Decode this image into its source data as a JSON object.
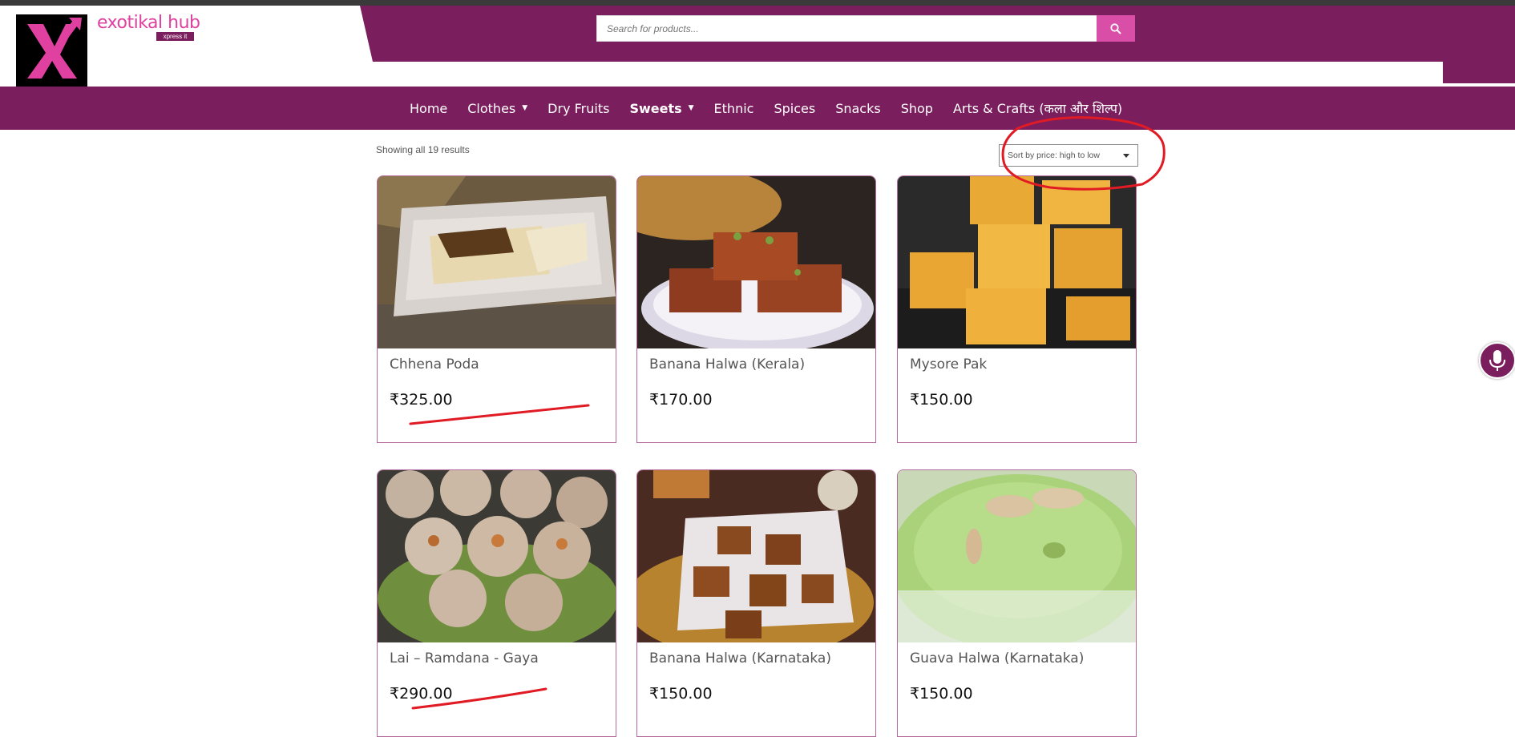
{
  "brand": {
    "name": "exotikal hub",
    "tagline": "xpress it",
    "logo_glyph": "X"
  },
  "search": {
    "placeholder": "Search for products...",
    "button_icon": "search-icon"
  },
  "nav": {
    "items": [
      {
        "label": "Home",
        "has_dropdown": false
      },
      {
        "label": "Clothes",
        "has_dropdown": true
      },
      {
        "label": "Dry Fruits",
        "has_dropdown": false
      },
      {
        "label": "Sweets",
        "has_dropdown": true,
        "active": true
      },
      {
        "label": "Ethnic",
        "has_dropdown": false
      },
      {
        "label": "Spices",
        "has_dropdown": false
      },
      {
        "label": "Snacks",
        "has_dropdown": false
      },
      {
        "label": "Shop",
        "has_dropdown": false
      },
      {
        "label": "Arts & Crafts (कला और शिल्प)",
        "has_dropdown": false
      }
    ]
  },
  "listing": {
    "results_text": "Showing all 19 results",
    "sort_value": "Sort by price: high to low"
  },
  "products": [
    {
      "name": "Chhena Poda",
      "price": "₹325.00"
    },
    {
      "name": "Banana Halwa (Kerala)",
      "price": "₹170.00"
    },
    {
      "name": "Mysore Pak",
      "price": "₹150.00"
    },
    {
      "name": "Lai – Ramdana - Gaya",
      "price": "₹290.00"
    },
    {
      "name": "Banana Halwa (Karnataka)",
      "price": "₹150.00"
    },
    {
      "name": "Guava Halwa (Karnataka)",
      "price": "₹150.00"
    }
  ],
  "colors": {
    "brand_purple": "#7b1e5e",
    "accent_pink": "#d94fa8",
    "annotation_red": "#e01b24"
  }
}
